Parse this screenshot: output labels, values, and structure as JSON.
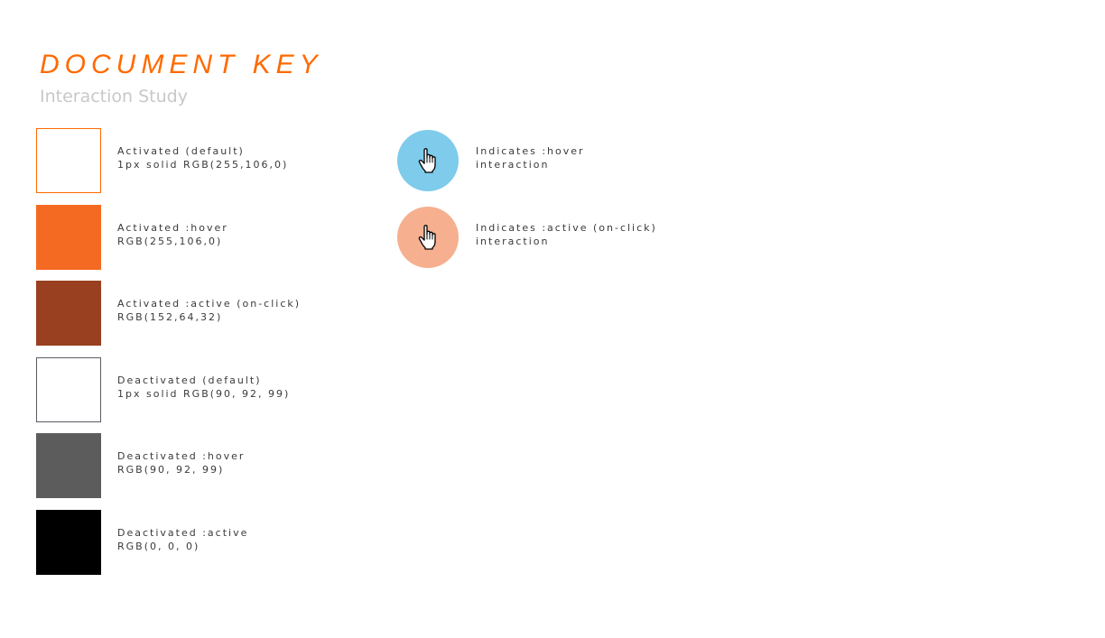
{
  "header": {
    "title": "DOCUMENT KEY",
    "subtitle": "Interaction Study"
  },
  "colors": {
    "accent": "#ff6a00",
    "subtitle": "#c8c8c8",
    "text": "#3a3a3a"
  },
  "swatches": [
    {
      "label": "Activated (default)",
      "detail": "1px solid RGB(255,106,0)",
      "fill": "#ffffff",
      "border": "#ff6a00"
    },
    {
      "label": "Activated :hover",
      "detail": "RGB(255,106,0)",
      "fill": "#f56a23",
      "border": "#f56a23"
    },
    {
      "label": "Activated :active (on-click)",
      "detail": "RGB(152,64,32)",
      "fill": "#984020",
      "border": "#984020"
    },
    {
      "label": "Deactivated (default)",
      "detail": "1px solid RGB(90, 92, 99)",
      "fill": "#ffffff",
      "border": "#5a5c63"
    },
    {
      "label": "Deactivated :hover",
      "detail": "RGB(90, 92, 99)",
      "fill": "#5b5c5b",
      "border": "#5b5c5b"
    },
    {
      "label": "Deactivated :active",
      "detail": "RGB(0, 0, 0)",
      "fill": "#000000",
      "border": "#000000"
    }
  ],
  "indicators": [
    {
      "icon": "hand-pointer-icon",
      "line1": "Indicates :hover",
      "line2": "interaction",
      "color": "#7ecbec"
    },
    {
      "icon": "hand-pointer-icon",
      "line1": "Indicates :active (on-click)",
      "line2": "interaction",
      "color": "#f6b08f"
    }
  ]
}
